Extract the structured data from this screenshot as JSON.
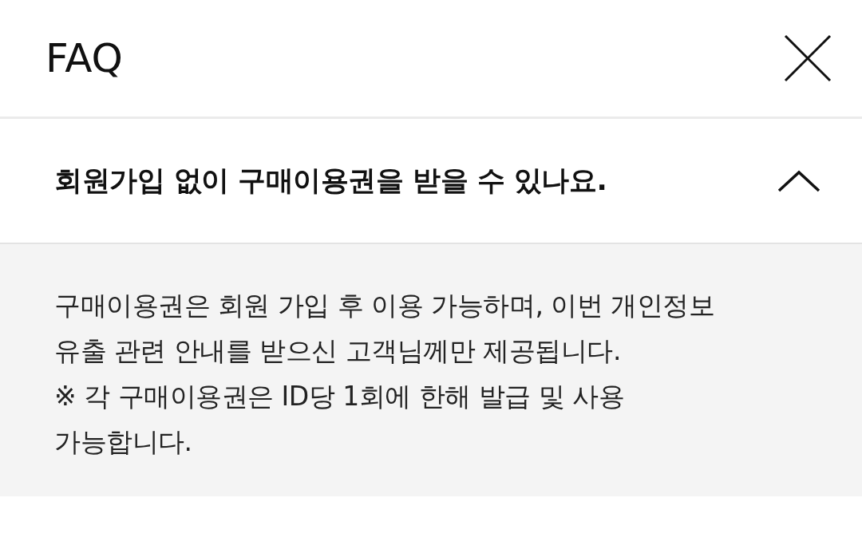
{
  "header": {
    "title": "FAQ"
  },
  "faq_items": [
    {
      "question": "회원가입 없이 구매이용권을 받을 수 있나요.",
      "expanded": true,
      "answer_lines": [
        "구매이용권은 회원 가입 후 이용 가능하며, 이번 개인정보",
        "유출 관련 안내를 받으신 고객님께만 제공됩니다.",
        "※ 각 구매이용권은 ID당 1회에 한해 발급 및 사용",
        "가능합니다."
      ]
    }
  ]
}
